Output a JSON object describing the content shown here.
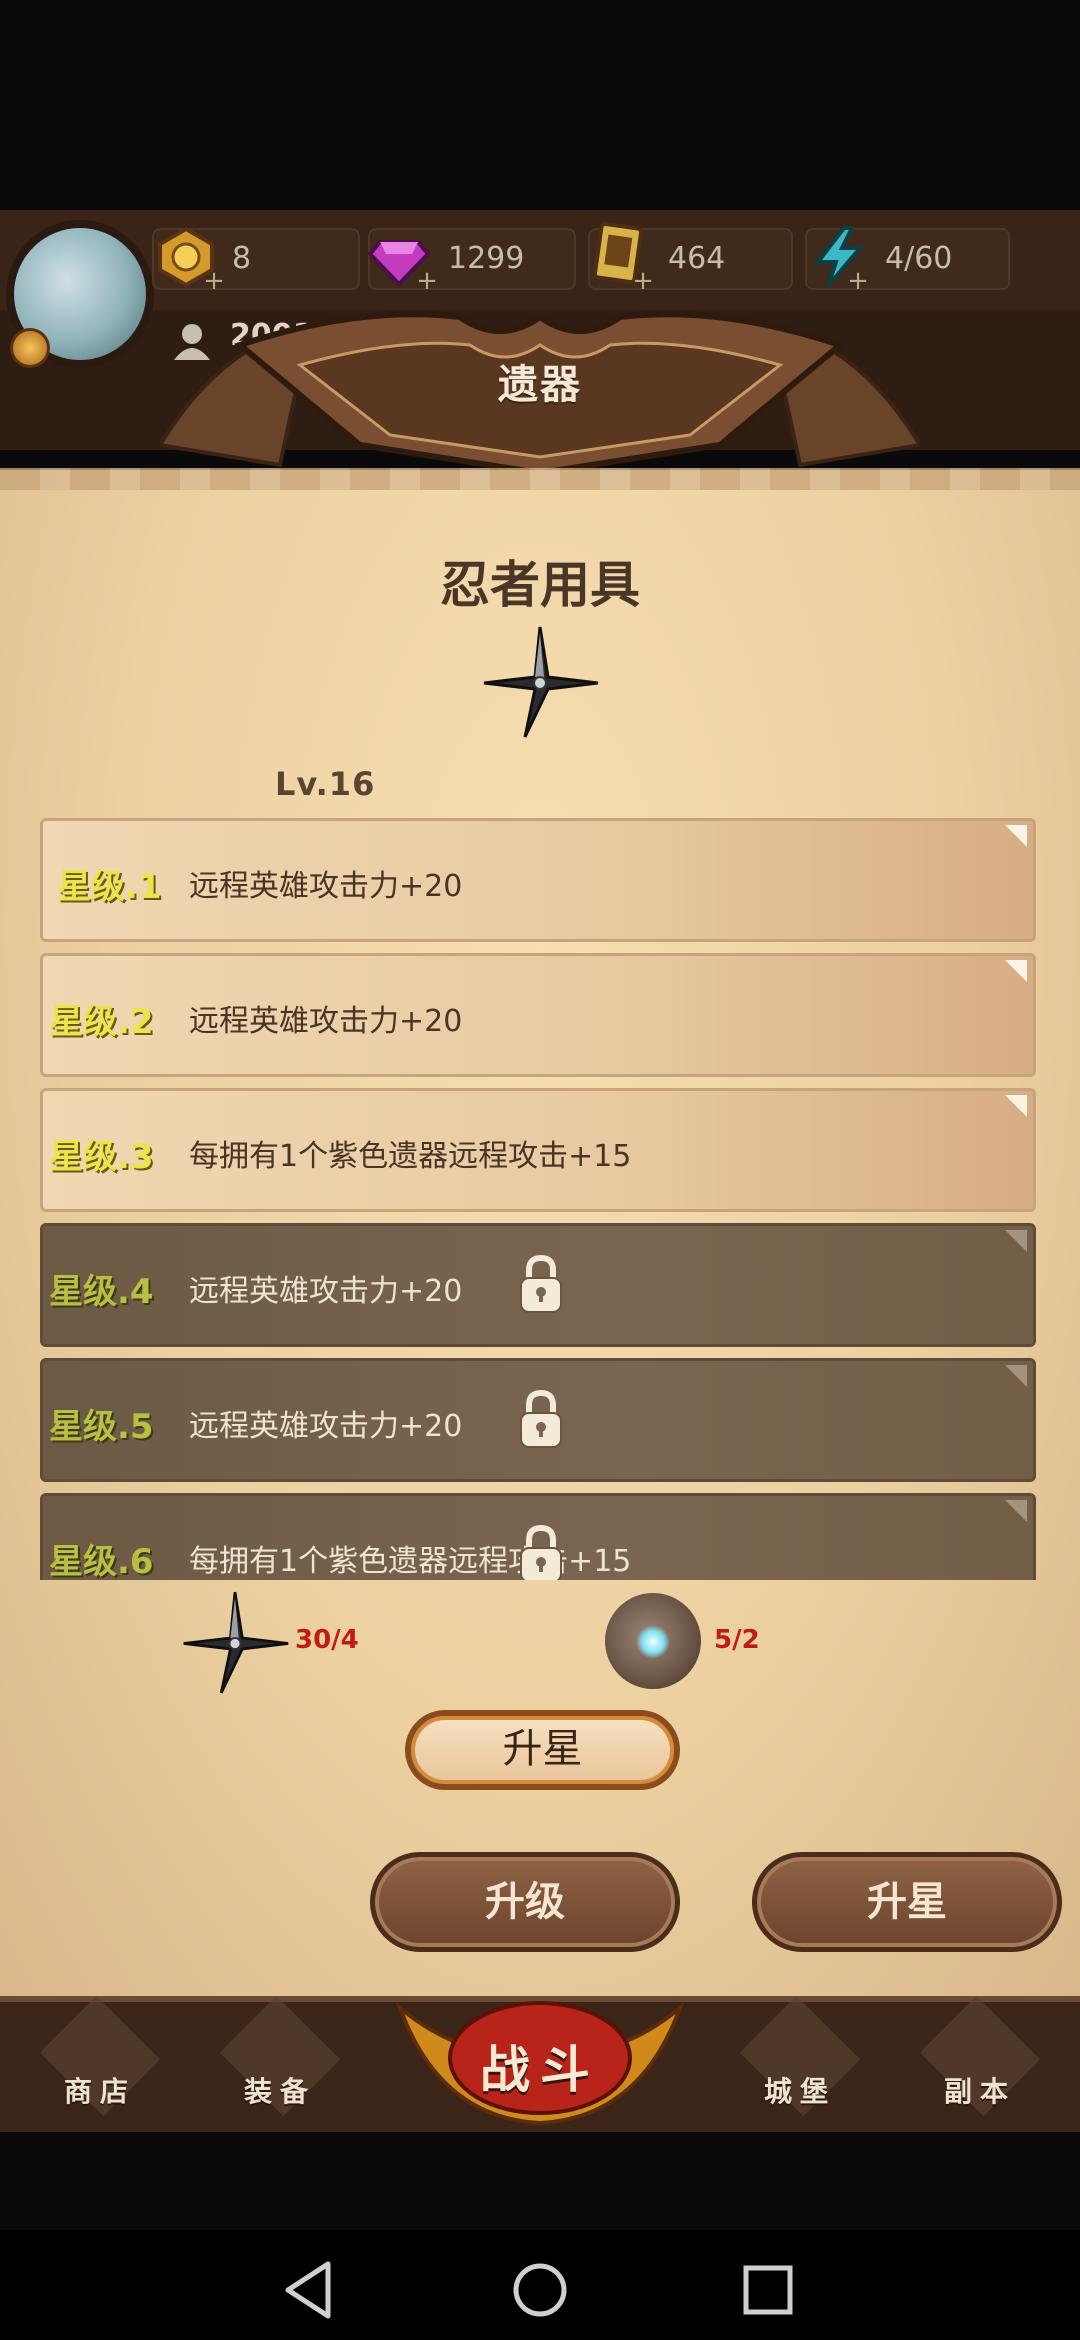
{
  "resources": [
    {
      "name": "gold-token",
      "value": "8"
    },
    {
      "name": "gem",
      "value": "1299"
    },
    {
      "name": "card",
      "value": "464"
    },
    {
      "name": "energy",
      "value": "4/60"
    }
  ],
  "player": {
    "id": "20011"
  },
  "header": {
    "title": "遗器"
  },
  "item": {
    "name": "忍者用具",
    "level": "Lv.16"
  },
  "stars": [
    {
      "label": "星级.1",
      "desc": "远程英雄攻击力+20",
      "locked": false
    },
    {
      "label": "星级.2",
      "desc": "远程英雄攻击力+20",
      "locked": false
    },
    {
      "label": "星级.3",
      "desc": "每拥有1个紫色遗器远程攻击+15",
      "locked": false
    },
    {
      "label": "星级.4",
      "desc": "远程英雄攻击力+20",
      "locked": true
    },
    {
      "label": "星级.5",
      "desc": "远程英雄攻击力+20",
      "locked": true
    },
    {
      "label": "星级.6",
      "desc": "每拥有1个紫色遗器远程攻击+15",
      "locked": true
    }
  ],
  "materials": {
    "shuriken": "30/4",
    "stone": "5/2"
  },
  "buttons": {
    "star_up_small": "升星",
    "upgrade": "升级",
    "star_up": "升星"
  },
  "nav": {
    "shop": "商店",
    "equip": "装备",
    "fight": "战斗",
    "castle": "城堡",
    "dungeon": "副本"
  },
  "colors": {
    "accent": "#c01d12",
    "parchment": "#ecd0a0",
    "dark_brown": "#3a2518"
  }
}
